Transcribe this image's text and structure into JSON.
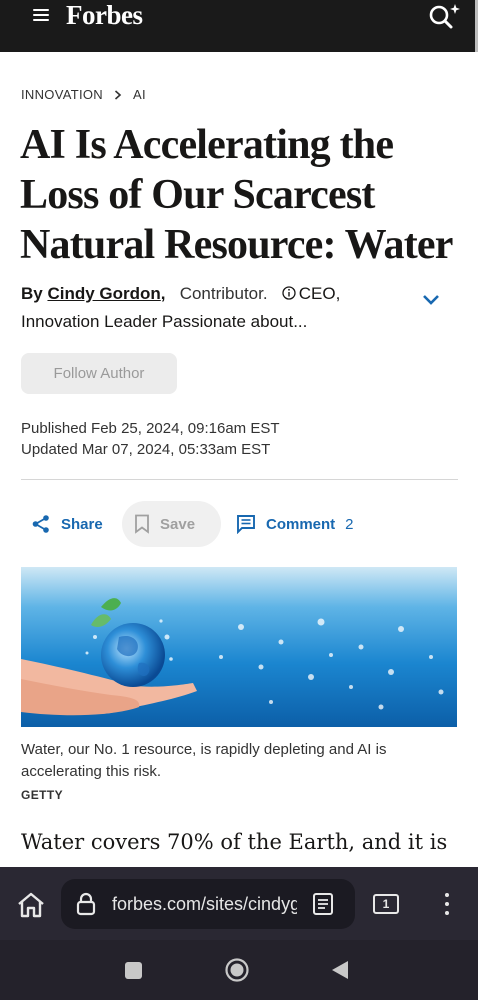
{
  "app": {
    "brand": "Forbes"
  },
  "article": {
    "breadcrumb": [
      "INNOVATION",
      "AI"
    ],
    "headline": "AI Is Accelerating the Loss of Our Scarcest Natural Resource: Water",
    "by_label": "By",
    "author": "Cindy Gordon",
    "author_suffix": ",",
    "contributor": "Contributor.",
    "role_line1": "CEO,",
    "role_line2": "Innovation Leader Passionate about...",
    "follow_label": "Follow Author",
    "published": "Published Feb 25, 2024, 09:16am EST",
    "updated": "Updated Mar 07, 2024, 05:33am EST",
    "actions": {
      "share": "Share",
      "save": "Save",
      "comment": "Comment",
      "comment_count": "2"
    },
    "image_caption": "Water, our No. 1 resource, is rapidly depleting and AI is accelerating this risk.",
    "image_credit": "GETTY",
    "body_start": "Water covers 70% of the Earth, and it is"
  },
  "browser": {
    "url": "forbes.com/sites/cindygordon",
    "tab_count": "1"
  },
  "colors": {
    "accent_link": "#1868b0",
    "topbar_bg": "#1a1a1a",
    "browser_bg": "#2a2833"
  }
}
